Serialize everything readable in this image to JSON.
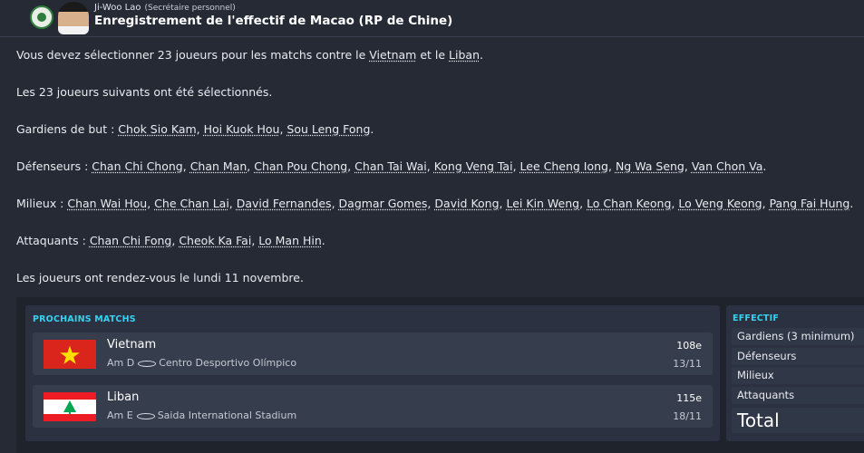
{
  "header": {
    "sender_name": "Ji-Woo Lao",
    "sender_role": "(Secrétaire personnel)",
    "subject": "Enregistrement de l'effectif de Macao (RP de Chine)"
  },
  "message": {
    "intro": {
      "before": "Vous devez sélectionner 23 joueurs pour les matchs contre le ",
      "link1": "Vietnam",
      "middle": " et le ",
      "link2": "Liban",
      "after": "."
    },
    "selected_line": "Les 23 joueurs suivants ont été sélectionnés.",
    "groups": [
      {
        "label": "Gardiens de but : ",
        "players": [
          "Chok Sio Kam",
          "Hoi Kuok Hou",
          "Sou Leng Fong"
        ]
      },
      {
        "label": "Défenseurs : ",
        "players": [
          "Chan Chi Chong",
          "Chan Man",
          "Chan Pou Chong",
          "Chan Tai Wai",
          "Kong Veng Tai",
          "Lee Cheng Iong",
          "Ng Wa Seng",
          "Van Chon Va"
        ]
      },
      {
        "label": "Milieux : ",
        "players": [
          "Chan Wai Hou",
          "Che Chan Lai",
          "David Fernandes",
          "Dagmar Gomes",
          "David Kong",
          "Lei Kin Weng",
          "Lo Chan Keong",
          "Lo Veng Keong",
          "Pang Fai Hung"
        ]
      },
      {
        "label": "Attaquants : ",
        "players": [
          "Chan Chi Fong",
          "Cheok Ka Fai",
          "Lo Man Hin"
        ]
      }
    ],
    "rendezvous": "Les joueurs ont rendez-vous le lundi 11 novembre."
  },
  "matches": {
    "title": "PROCHAINS MATCHS",
    "items": [
      {
        "opponent": "Vietnam",
        "type": "Am",
        "venue_code": "D",
        "stadium": "Centro Desportivo Olímpico",
        "rank": "108e",
        "date": "13/11",
        "flag": "vietnam-flag"
      },
      {
        "opponent": "Liban",
        "type": "Am",
        "venue_code": "E",
        "stadium": "Saida International Stadium",
        "rank": "115e",
        "date": "18/11",
        "flag": "lebanon-flag"
      }
    ]
  },
  "effectif": {
    "title": "EFFECTIF",
    "rows": [
      "Gardiens (3 minimum)",
      "Défenseurs",
      "Milieux",
      "Attaquants"
    ],
    "total": "Total"
  },
  "colors": {
    "background": "#252a35",
    "accent": "#35d2f0",
    "vietnam_red": "#da251d",
    "vietnam_star": "#ffde00",
    "lebanon_red": "#ed1c24",
    "lebanon_cedar": "#00a651"
  }
}
